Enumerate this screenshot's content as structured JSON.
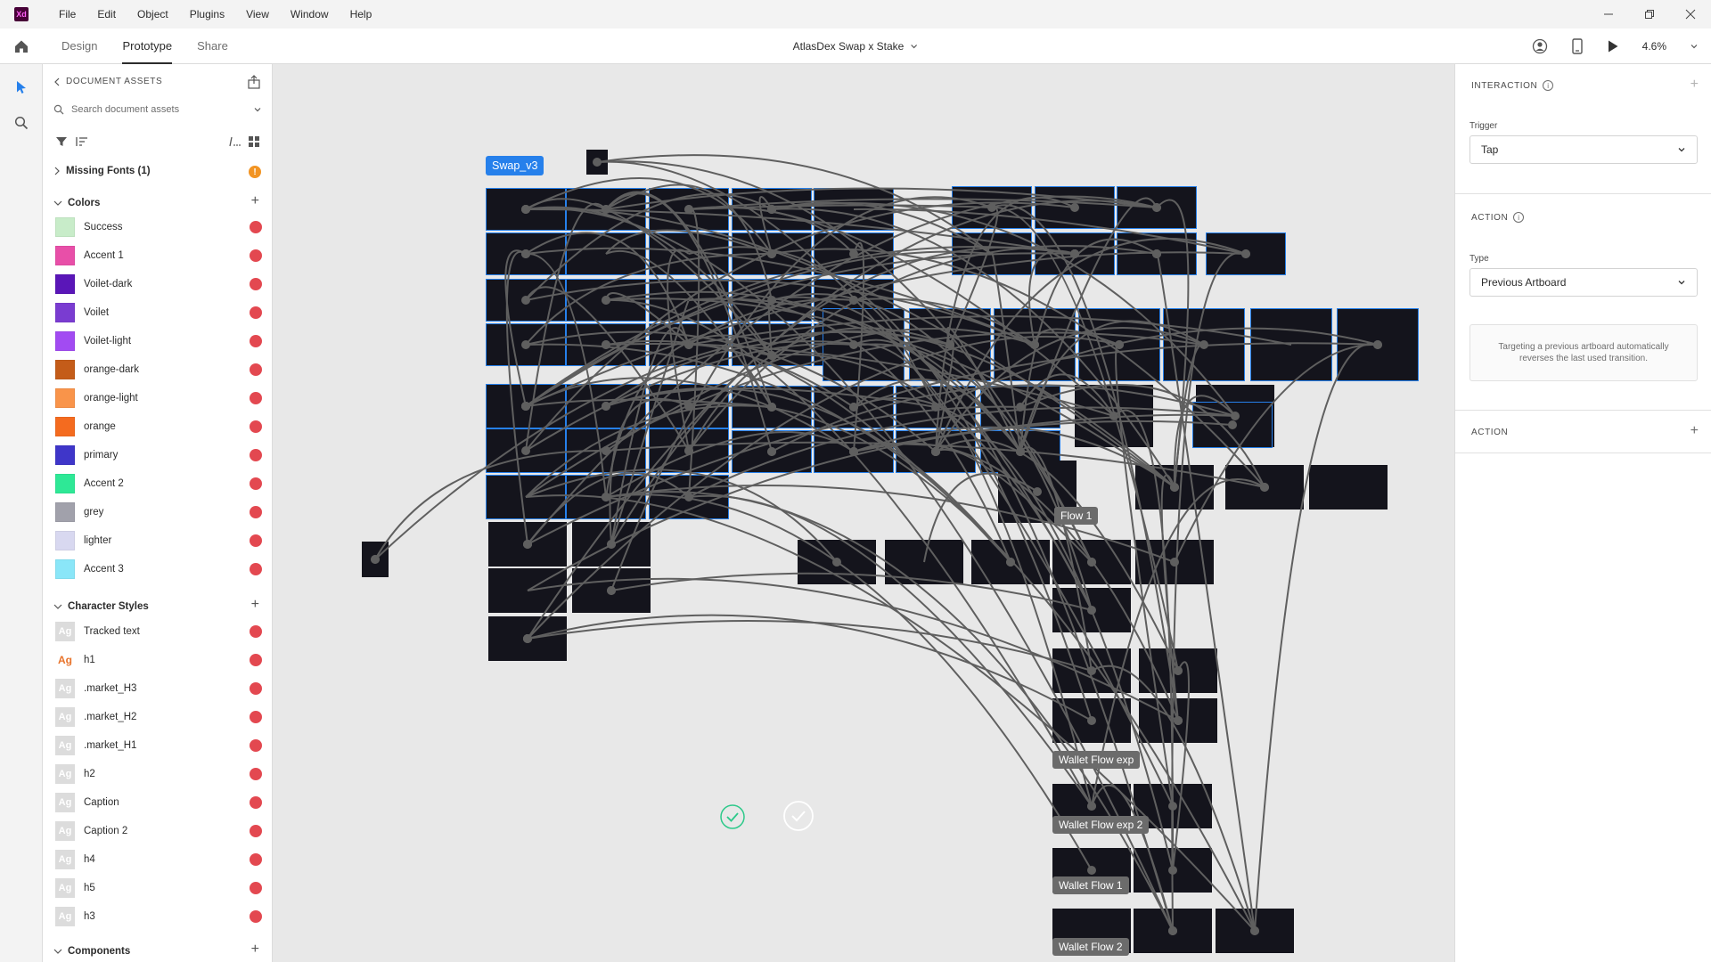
{
  "app": {
    "logo": "Xd",
    "menu": [
      "File",
      "Edit",
      "Object",
      "Plugins",
      "View",
      "Window",
      "Help"
    ]
  },
  "toolbar": {
    "tabs": [
      "Design",
      "Prototype",
      "Share"
    ],
    "active_tab": "Prototype",
    "doc_title": "AtlasDex Swap x Stake",
    "zoom": "4.6%"
  },
  "assets": {
    "title": "DOCUMENT ASSETS",
    "search_placeholder": "Search document assets",
    "missing_fonts": "Missing Fonts (1)",
    "colors_title": "Colors",
    "colors": [
      {
        "name": "Success",
        "hex": "#c8ecc9"
      },
      {
        "name": "Accent 1",
        "hex": "#e84fa8"
      },
      {
        "name": "Voilet-dark",
        "hex": "#5a16b8"
      },
      {
        "name": "Voilet",
        "hex": "#7a3cd1"
      },
      {
        "name": "Voilet-light",
        "hex": "#a24bf2"
      },
      {
        "name": "orange-dark",
        "hex": "#c45c19"
      },
      {
        "name": "orange-light",
        "hex": "#f9944a"
      },
      {
        "name": "orange",
        "hex": "#f46b1f"
      },
      {
        "name": "primary",
        "hex": "#3f36c9"
      },
      {
        "name": "Accent 2",
        "hex": "#2ee896"
      },
      {
        "name": "grey",
        "hex": "#a1a1ab"
      },
      {
        "name": "lighter",
        "hex": "#d8d8f0"
      },
      {
        "name": "Accent 3",
        "hex": "#8ae6f8"
      }
    ],
    "char_styles_title": "Character Styles",
    "char_styles": [
      "Tracked text",
      "h1",
      ".market_H3",
      ".market_H2",
      ".market_H1",
      "h2",
      "Caption",
      "Caption 2",
      "h4",
      "h5",
      "h3"
    ],
    "ag_label": "Ag",
    "components_title": "Components"
  },
  "canvas": {
    "flows": {
      "swap_v3": "Swap_v3",
      "flow1": "Flow 1",
      "wallet_flow_exp": "Wallet Flow exp",
      "wallet_flow_exp2": "Wallet Flow exp 2",
      "wallet_flow1": "Wallet Flow 1",
      "wallet_flow2": "Wallet Flow 2"
    }
  },
  "props": {
    "interaction_title": "INTERACTION",
    "trigger_label": "Trigger",
    "trigger_value": "Tap",
    "action_title": "ACTION",
    "type_label": "Type",
    "type_value": "Previous Artboard",
    "note": "Targeting a previous artboard automatically reverses the last used transition.",
    "action2_title": "ACTION"
  },
  "colors": {
    "accent_blue": "#2680eb",
    "link_red": "#e34850",
    "warning_orange": "#f29423"
  }
}
